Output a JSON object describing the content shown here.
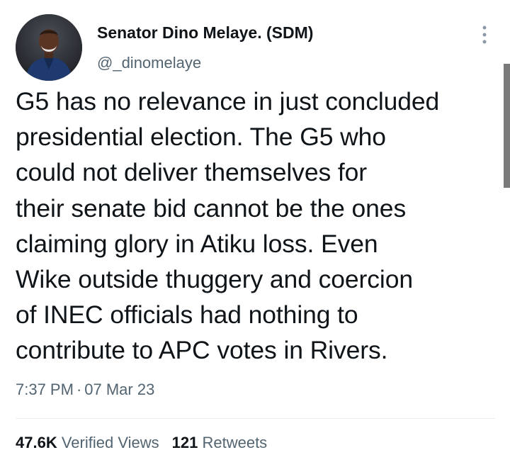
{
  "author": {
    "name": "Senator Dino Melaye. (SDM)",
    "handle": "@_dinomelaye"
  },
  "more_icon": "more-vertical-icon",
  "tweet": {
    "lines": [
      "G5 has no relevance in just concluded",
      "presidential election. The G5 who",
      "could not deliver themselves  for",
      "their senate bid cannot be the ones",
      "claiming glory in Atiku loss. Even",
      "Wike outside thuggery and coercion",
      "of INEC officials had nothing to",
      "contribute to APC votes in Rivers."
    ],
    "time": "7:37 PM",
    "separator": "·",
    "date": "07 Mar 23"
  },
  "stats": {
    "views_count": "47.6K",
    "views_label": "Verified Views",
    "retweets_count": "121",
    "retweets_label": "Retweets"
  },
  "colors": {
    "primary_text": "#0f1419",
    "secondary_text": "#536471",
    "divider": "#e6ecf0",
    "scrollbar": "#7a7a7a"
  }
}
